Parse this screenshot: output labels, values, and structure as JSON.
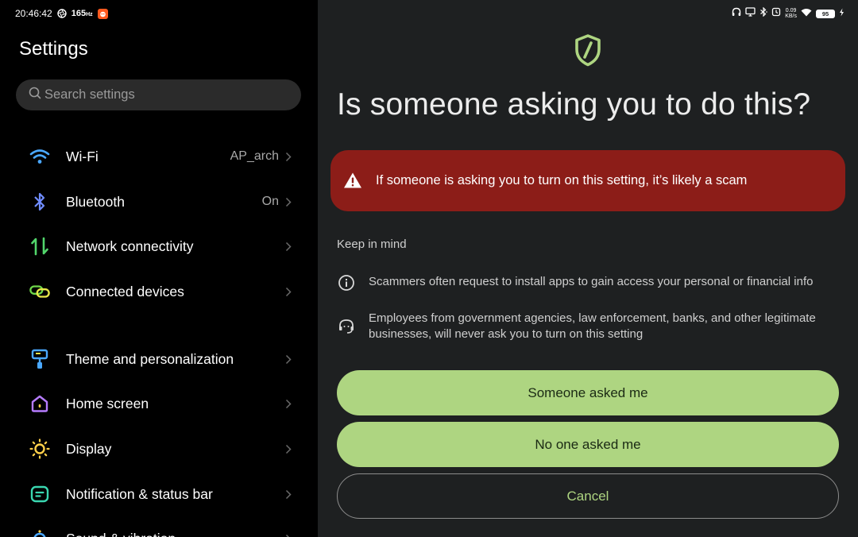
{
  "status_bar": {
    "time": "20:46:42",
    "refresh_rate": "165",
    "refresh_unit": "Hz",
    "net_speed_value": "0.09",
    "net_speed_unit": "KB/s",
    "battery": "95",
    "icons_left": [
      "aperture-icon",
      "app-notification-icon"
    ],
    "icons_right": [
      "headphones-icon",
      "cast-icon",
      "bluetooth-icon",
      "alarm-icon",
      "wifi-icon",
      "battery-icon",
      "charging-icon"
    ]
  },
  "settings": {
    "title": "Settings",
    "search_placeholder": "Search settings",
    "items": [
      {
        "label": "Wi-Fi",
        "value": "AP_arch",
        "icon": "wifi-icon",
        "color": "#4aa8ff"
      },
      {
        "label": "Bluetooth",
        "value": "On",
        "icon": "bluetooth-icon",
        "color": "#6f8cff"
      },
      {
        "label": "Network connectivity",
        "value": "",
        "icon": "network-arrows-icon",
        "color": "#52d66b"
      },
      {
        "label": "Connected devices",
        "value": "",
        "icon": "linked-rings-icon",
        "color": "#6fd64a"
      },
      {
        "label": "Theme and personalization",
        "value": "",
        "icon": "paint-roller-icon",
        "color": "#4aa8ff"
      },
      {
        "label": "Home screen",
        "value": "",
        "icon": "home-icon",
        "color": "#b67cff"
      },
      {
        "label": "Display",
        "value": "",
        "icon": "sun-icon",
        "color": "#ffd04a"
      },
      {
        "label": "Notification & status bar",
        "value": "",
        "icon": "notification-icon",
        "color": "#3ad6b0"
      },
      {
        "label": "Sound & vibration",
        "value": "",
        "icon": "sound-icon",
        "color": "#4aa8ff"
      }
    ]
  },
  "dialog": {
    "title": "Is someone asking you to do this?",
    "warning": "If someone is asking you to turn on this setting, it’s likely a scam",
    "keep_in_mind": "Keep in mind",
    "tips": [
      {
        "icon": "info-icon",
        "text": "Scammers often request to install apps to gain access your personal or financial info"
      },
      {
        "icon": "support-agent-icon",
        "text": "Employees from government agencies, law enforcement, banks, and other legitimate businesses, will never ask you to turn on this setting"
      }
    ],
    "buttons": {
      "someone_asked": "Someone asked me",
      "no_one_asked": "No one asked me",
      "cancel": "Cancel"
    },
    "colors": {
      "accent": "#aed581",
      "warning_bg": "#8c1d18",
      "surface": "#1e2021"
    }
  }
}
